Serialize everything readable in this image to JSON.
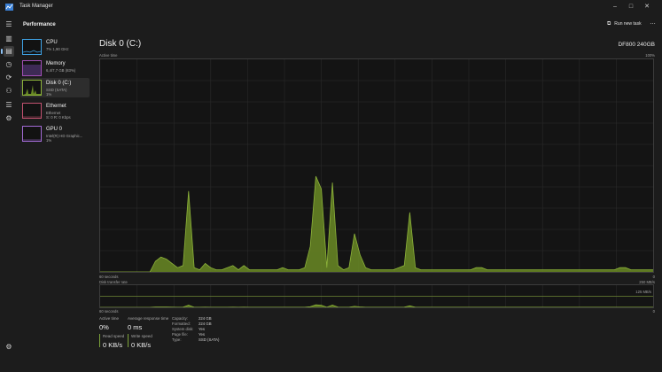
{
  "window": {
    "title": "Task Manager"
  },
  "header": {
    "page_title": "Performance",
    "run_task_label": "Run new task",
    "more_label": "…"
  },
  "sidebar": {
    "items": [
      {
        "name": "CPU",
        "line1": "7%  1,90 GHz",
        "line2": ""
      },
      {
        "name": "Memory",
        "line1": "6,4/7,7 GB (83%)",
        "line2": ""
      },
      {
        "name": "Disk 0 (C:)",
        "line1": "SSD (SATA)",
        "line2": "1%"
      },
      {
        "name": "Ethernet",
        "line1": "Ethernet",
        "line2": "S: 0  R: 0 Kbps"
      },
      {
        "name": "GPU 0",
        "line1": "Intel(R) HD Graphic...",
        "line2": "1%"
      }
    ]
  },
  "main": {
    "title": "Disk 0 (C:)",
    "model": "DF800 240GB",
    "active_label": "Active time",
    "active_max": "100%",
    "active_time_left": "60 seconds",
    "active_time_right": "0",
    "transfer_label": "Disk transfer rate",
    "transfer_max": "250 MB/s",
    "transfer_mid": "125 MB/s",
    "transfer_time_left": "60 seconds",
    "transfer_time_right": "0"
  },
  "stats": {
    "active_time": {
      "label": "Active time",
      "value": "0%"
    },
    "response": {
      "label": "Average response time",
      "value": "0 ms"
    },
    "read": {
      "label": "Read speed",
      "value": "0 KB/s"
    },
    "write": {
      "label": "Write speed",
      "value": "0 KB/s"
    }
  },
  "properties": [
    {
      "key": "Capacity:",
      "value": "224 GB"
    },
    {
      "key": "Formatted:",
      "value": "224 GB"
    },
    {
      "key": "System disk:",
      "value": "Yes"
    },
    {
      "key": "Page file:",
      "value": "Yes"
    },
    {
      "key": "Type:",
      "value": "SSD (SATA)"
    }
  ],
  "chart_data": {
    "type": "area",
    "series": [
      {
        "values": [
          0,
          0,
          0,
          0,
          0,
          0,
          0,
          0,
          0,
          0,
          5,
          7,
          6,
          4,
          2,
          3,
          38,
          2,
          1,
          4,
          2,
          1,
          1,
          2,
          3,
          1,
          3,
          1,
          1,
          1,
          1,
          1,
          1,
          2,
          1,
          1,
          1,
          2,
          12,
          45,
          39,
          2,
          42,
          3,
          1,
          2,
          18,
          8,
          2,
          1,
          1,
          1,
          1,
          1,
          2,
          3,
          28,
          2,
          1,
          1,
          1,
          1,
          1,
          1,
          1,
          1,
          1,
          1,
          2,
          2,
          1,
          1,
          1,
          1,
          1,
          1,
          1,
          1,
          1,
          1,
          1,
          1,
          1,
          1,
          1,
          1,
          1,
          1,
          1,
          1,
          1,
          1,
          1,
          1,
          2,
          2,
          1,
          1,
          1,
          1,
          1
        ],
        "colors": {
          "line": "#8db33a",
          "fill": "#6a8a25"
        }
      }
    ],
    "ylim": [
      0,
      100
    ],
    "grid": true
  },
  "colors": {
    "accent": "#8ec2f5",
    "disk": "#8db33a",
    "cpu": "#3fa3e6",
    "memory": "#a14fb5",
    "ethernet": "#c2516f",
    "gpu": "#a36bd6"
  }
}
